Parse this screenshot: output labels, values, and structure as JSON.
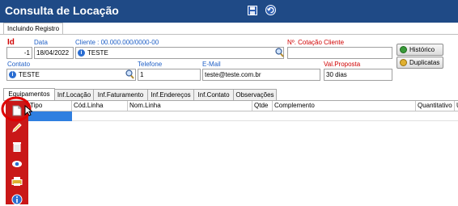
{
  "window": {
    "title": "Consulta de Locação"
  },
  "toolbar_top": {
    "save_icon": "floppy-save-icon",
    "back_icon": "undo-icon"
  },
  "mode_tab": {
    "label": "Incluindo Registro"
  },
  "form": {
    "id_label": "Id",
    "id_value": "-1",
    "data_label": "Data",
    "data_value": "18/04/2022",
    "cliente_label": "Cliente : 00.000.000/0000-00",
    "cliente_value": "TESTE",
    "cotacao_label": "Nº. Cotação Cliente",
    "cotacao_value": "",
    "contato_label": "Contato",
    "contato_value": "TESTE",
    "telefone_label": "Telefone",
    "telefone_value": "1",
    "email_label": "E-Mail",
    "email_value": "teste@teste.com.br",
    "valproposta_label": "Val.Proposta",
    "valproposta_value": "30 dias"
  },
  "buttons": {
    "historico": "Histórico",
    "duplicatas": "Duplicatas"
  },
  "tabs": [
    "Equipamentos",
    "Inf.Locação",
    "Inf.Faturamento",
    "Inf.Endereços",
    "Inf.Contato",
    "Observações"
  ],
  "grid": {
    "columns": [
      "Tipo",
      "Cód.Linha",
      "Nom.Linha",
      "Qtde",
      "Complemento",
      "Quantitativo",
      "U"
    ]
  },
  "side_toolbar": {
    "icons": [
      "new-document-icon",
      "edit-pencil-icon",
      "delete-trash-icon",
      "view-eye-icon",
      "print-icon",
      "info-icon"
    ]
  },
  "colors": {
    "titlebar": "#1f4a86",
    "side_toolbar": "#c91818",
    "highlight_circle": "#e00000",
    "required_label": "#d00000",
    "field_label": "#1f5fc6"
  }
}
